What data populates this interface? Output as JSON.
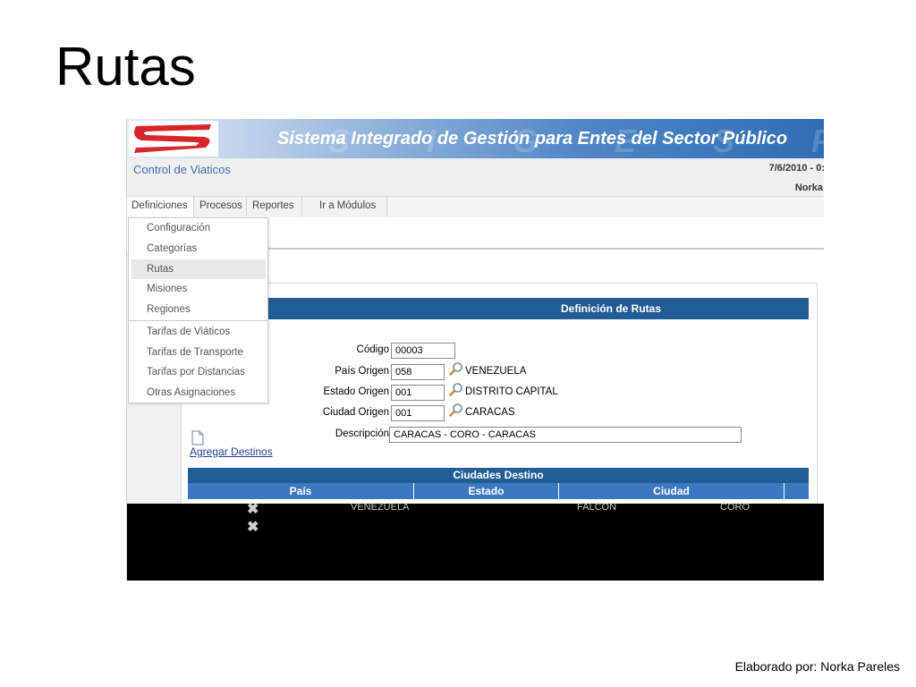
{
  "slide": {
    "title": "Rutas",
    "footer": "Elaborado por: Norka Pareles"
  },
  "app": {
    "system_title": "Sistema Integrado de Gestión para Entes del Sector Público",
    "watermark": "S I G E S P",
    "module_title": "Control de Viaticos",
    "date": "7/6/2010 - 0:",
    "user": "Norka"
  },
  "menu": {
    "items": [
      "Definiciones",
      "Procesos",
      "Reportes",
      "Ir a Módulos"
    ]
  },
  "dropdown": {
    "items": [
      "Configuración",
      "Categorías",
      "Rutas",
      "Misiones",
      "Regiones",
      "Tarifas de Viáticos",
      "Tarifas de Transporte",
      "Tarifas por Distancias",
      "Otras Asignaciones"
    ],
    "active": "Rutas"
  },
  "form": {
    "section_title": "Definición de Rutas",
    "codigo_label": "Código",
    "codigo_value": "00003",
    "pais_label": "País Origen",
    "pais_code": "058",
    "pais_name": "VENEZUELA",
    "estado_label": "Estado Origen",
    "estado_code": "001",
    "estado_name": "DISTRITO CAPITAL",
    "ciudad_label": "Ciudad Origen",
    "ciudad_code": "001",
    "ciudad_name": "CARACAS",
    "descripcion_label": "Descripción",
    "descripcion_value": "CARACAS - CORO - CARACAS"
  },
  "destinos": {
    "add_link": "Agregar Destinos",
    "title": "Ciudades Destino",
    "columns": [
      "País",
      "Estado",
      "Ciudad"
    ],
    "rows": [
      {
        "pais": "VENEZUELA",
        "estado": "FALCON",
        "ciudad": "CORO"
      }
    ]
  },
  "colors": {
    "header_blue": "#225c94",
    "column_blue": "#3b78c0",
    "brand_red": "#d6262b",
    "module_title_blue": "#3f6db0"
  }
}
